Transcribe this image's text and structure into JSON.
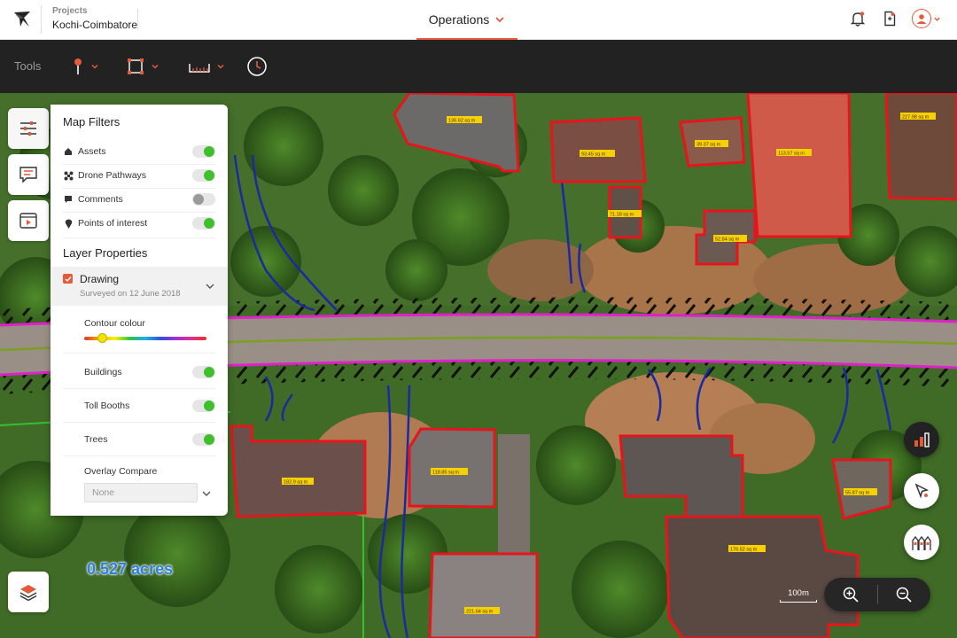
{
  "header": {
    "project_caption": "Projects",
    "project_name": "Kochi-Coimbatore",
    "mode": "Operations",
    "icons": [
      "bell-icon",
      "document-icon",
      "user-icon"
    ]
  },
  "tools": {
    "label": "Tools",
    "items": [
      {
        "name": "pin-tool",
        "icon": "map-pin-icon"
      },
      {
        "name": "area-tool",
        "icon": "select-area-icon"
      },
      {
        "name": "measure-tool",
        "icon": "ruler-icon"
      },
      {
        "name": "history-tool",
        "icon": "clock-icon"
      }
    ]
  },
  "filters": {
    "title": "Map Filters",
    "items": [
      {
        "label": "Assets",
        "on": true,
        "icon": "home-icon"
      },
      {
        "label": "Drone Pathways",
        "on": true,
        "icon": "drone-icon"
      },
      {
        "label": "Comments",
        "on": false,
        "icon": "comment-icon"
      },
      {
        "label": "Points of interest",
        "on": true,
        "icon": "pin-icon"
      }
    ]
  },
  "layer_properties": {
    "title": "Layer Properties",
    "layer": {
      "name": "Drawing",
      "subtitle": "Surveyed on 12 June 2018",
      "checked": true
    },
    "contour_label": "Contour colour",
    "contour_value": 0.15,
    "toggles": [
      {
        "label": "Buildings",
        "on": true
      },
      {
        "label": "Toll Booths",
        "on": true
      },
      {
        "label": "Trees",
        "on": true
      }
    ],
    "overlay_label": "Overlay Compare",
    "overlay_value": "None"
  },
  "map": {
    "area_readout": "0.527 acres",
    "scale_label": "100m",
    "building_labels": [
      "136.62 sq m",
      "93.45 sq m",
      "39.37 sq m",
      "113.57 sq m",
      "227.98 sq m",
      "71.18 sq m",
      "52.84 sq m",
      "182.9 sq m",
      "118.85 sq m",
      "176.52 sq m",
      "55.87 sq m",
      "221.64 sq m"
    ]
  },
  "colors": {
    "accent": "#e25a3a",
    "toggle_on": "#3fbf2c",
    "building_outline": "#e8141c",
    "road_edge": "#e020c8",
    "road_center": "#7aa020",
    "contour": "#1a2aa0"
  }
}
